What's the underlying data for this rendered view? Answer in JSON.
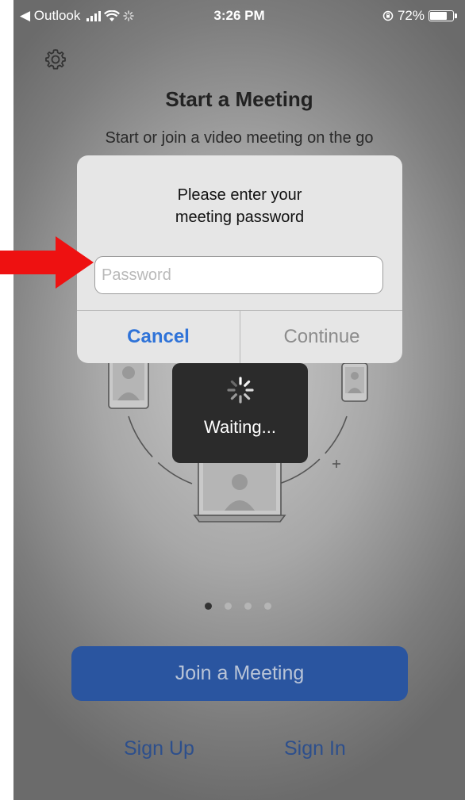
{
  "status_bar": {
    "back_app": "◀ Outlook",
    "time": "3:26 PM",
    "battery": "72%"
  },
  "main": {
    "title": "Start a Meeting",
    "subtitle": "Start or join a video meeting on the go"
  },
  "dialog": {
    "message_line1": "Please enter your",
    "message_line2": "meeting password",
    "password_placeholder": "Password",
    "password_value": "",
    "cancel_label": "Cancel",
    "continue_label": "Continue"
  },
  "loading": {
    "label": "Waiting..."
  },
  "pager": {
    "pages": 4,
    "active": 1
  },
  "actions": {
    "join_label": "Join a Meeting",
    "signup_label": "Sign Up",
    "signin_label": "Sign In"
  },
  "icons": {
    "settings": "gear-icon",
    "wifi": "wifi-icon",
    "signal": "cellular-signal-icon",
    "battery": "battery-icon",
    "spinner": "spinner-icon",
    "annotation": "red-arrow-icon"
  },
  "colors": {
    "accent": "#2f73d8",
    "join_button": "#2a55a0",
    "arrow": "#ee1111"
  }
}
